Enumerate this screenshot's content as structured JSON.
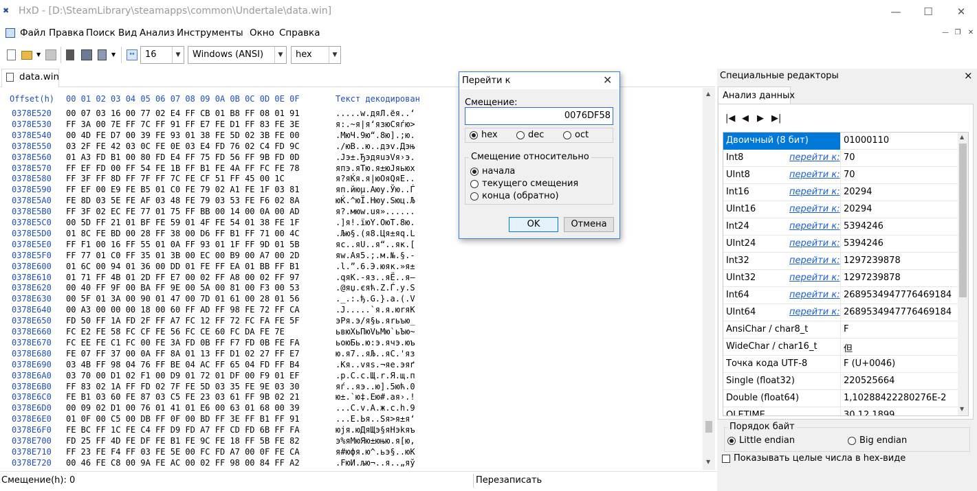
{
  "window": {
    "app_icon": "HxD-icon",
    "title": "HxD - [D:\\SteamLibrary\\steamapps\\common\\Undertale\\data.win]",
    "minimize": "—",
    "maximize": "☐",
    "close": "✕"
  },
  "menu": [
    "Файл",
    "Правка",
    "Поиск",
    "Вид",
    "Анализ",
    "Инструменты",
    "Окно",
    "Справка"
  ],
  "toolbar": {
    "bytes_per_row": "16",
    "charset": "Windows (ANSI)",
    "offset_base": "hex"
  },
  "editor_tab": "data.win",
  "hex_header": {
    "offset_label": "Offset(h)",
    "columns": "00 01 02 03 04 05 06 07 08 09 0A 0B 0C 0D 0E 0F",
    "text_label": "Текст декодирован"
  },
  "hex_rows": [
    {
      "offset": "0378E520",
      "bytes": "00 07 03 16 00 77 02 E4 FF CB 01 B8 FF 08 01 91",
      "text": ".....w.дяЛ.ёя..‘"
    },
    {
      "offset": "0378E530",
      "bytes": "FF 3A 00 7E FF 7C FF 91 FF E7 FE D1 FF 83 FE 3E",
      "text": "я:.~я|я‘язюСяѓю>"
    },
    {
      "offset": "0378E540",
      "bytes": "00 4D FE D7 00 39 FE 93 01 38 FE 5D 02 3B FE 00",
      "text": ".MюЧ.9ю“.8ю].;ю."
    },
    {
      "offset": "0378E550",
      "bytes": "03 2F FE 42 03 0C FE 0E 03 E4 FD 76 02 C4 FD 9C",
      "text": "./юB..ю..дэv.Дэњ"
    },
    {
      "offset": "0378E560",
      "bytes": "01 A3 FD B1 00 80 FD E4 FF 75 FD 56 FF 9B FD 0D",
      "text": ".Јэ±.ЂэдяuэVя›э."
    },
    {
      "offset": "0378E570",
      "bytes": "FF EF FD 00 FF 54 FE 1B FF B1 FE 4A FF FC FE 78",
      "text": "япэ.яTю.я±юJяьюx"
    },
    {
      "offset": "0378E580",
      "bytes": "FF 3F FF 8D FF 7F FF 7C FE CF 51 FF 45 00 1C",
      "text": "я?яЌя.я|юОяQяE.."
    },
    {
      "offset": "0378E590",
      "bytes": "FF EF 00 E9 FE B5 01 C0 FE 79 02 A1 FE 1F 03 81",
      "text": "яп.йюµ.Аюy.Ўю..Ѓ"
    },
    {
      "offset": "0378E5A0",
      "bytes": "FE 8D 03 5E FE AF 03 48 FE 79 03 53 FE F6 02 8A",
      "text": "юЌ.^юЇ.Hюy.Sюц.Љ"
    },
    {
      "offset": "0378E5B0",
      "bytes": "FF 3F 02 EC FE 77 01 75 FF BB 00 14 00 0A 00 AD",
      "text": "я?.мюw.uя»......"
    },
    {
      "offset": "0378E5C0",
      "bytes": "00 5D FF 21 01 BF FE 59 01 4F FE 54 01 38 FE 1F",
      "text": ".]я!.їюY.OюT.8ю."
    },
    {
      "offset": "0378E5D0",
      "bytes": "01 8C FE BD 00 28 FF 38 00 D6 FF B1 FF 71 00 4C",
      "text": ".Љю§.(я8.Ця±яq.L"
    },
    {
      "offset": "0378E5E0",
      "bytes": "FF F1 00 16 FF 55 01 0A FF 93 01 1F FF 9D 01 5B",
      "text": "яс..яU..я“..як.["
    },
    {
      "offset": "0378E5F0",
      "bytes": "FF 77 01 C0 FF 35 01 3B 00 EC 00 B9 00 A7 00 2D",
      "text": "яw.Ая5.;.м.№.§.-"
    },
    {
      "offset": "0378E600",
      "bytes": "01 6C 00 94 01 36 00 DD 01 FE FF EA 01 BB FF B1",
      "text": ".l.”.6.Э.юяк.»я±"
    },
    {
      "offset": "0378E610",
      "bytes": "01 71 FF 4B 01 2D FF E7 00 02 FF A8 00 02 FF 97",
      "text": ".qяK.-яз..яЁ..я—"
    },
    {
      "offset": "0378E620",
      "bytes": "00 40 FF 9F 00 BA FF 9E 00 5A 00 81 00 F3 00 53",
      "text": ".@яџ.єяћ.Z.Ѓ.у.S"
    },
    {
      "offset": "0378E630",
      "bytes": "00 5F 01 3A 00 90 01 47 00 7D 01 61 00 28 01 56",
      "text": "._.:.ђ.G.}.a.(.V"
    },
    {
      "offset": "0378E640",
      "bytes": "00 A3 00 00 00 18 00 60 FF AD FF 98 FE 72 FF CA",
      "text": ".Ј.....`я.я.юrяК"
    },
    {
      "offset": "0378E650",
      "bytes": "FD 50 FF 1A FD 2F FF A7 FC 12 FF 72 FC FA FE 5F",
      "text": "эPя.э/я§ь.яrьъю_"
    },
    {
      "offset": "0378E660",
      "bytes": "FC E2 FE 58 FC CF FE 56 FC CE 60 FC DA FE 7E",
      "text": "ьвюXьПюVьМю`ьЪю~"
    },
    {
      "offset": "0378E670",
      "bytes": "FC EE FE C1 FC 00 FE 3A FD 0B FF F7 FD 0B FE FA",
      "text": "ьоюБь.ю:э.ячэ.юъ"
    },
    {
      "offset": "0378E680",
      "bytes": "FE 07 FF 37 00 0A FF 8A 01 13 FF D1 02 27 FF E7",
      "text": "ю.я7..яЉ..яС.'яз"
    },
    {
      "offset": "0378E690",
      "bytes": "03 4B FF 98 04 76 FF BE 04 AC FF 65 04 FD FF B4",
      "text": ".Kя..vяѕ.¬яe.эяґ"
    },
    {
      "offset": "0378E6A0",
      "bytes": "03 70 00 D1 02 F1 00 D9 01 72 01 DF 00 F9 01 EF",
      "text": ".p.С.с.Щ.r.Я.щ.п"
    },
    {
      "offset": "0378E6B0",
      "bytes": "FF 83 02 1A FF FD 02 7F FE 5D 03 35 FE 9E 03 30",
      "text": "яѓ..яэ..ю].5юћ.0"
    },
    {
      "offset": "0378E6C0",
      "bytes": "FE B1 03 60 FE 87 03 C5 FE 23 03 61 FF 9B 02 21",
      "text": "ю±.`ю‡.Ею#.aя›.!"
    },
    {
      "offset": "0378E6D0",
      "bytes": "00 09 02 D1 00 76 01 41 01 E6 00 63 01 68 00 39",
      "text": "...С.v.A.ж.c.h.9"
    },
    {
      "offset": "0378E6E0",
      "bytes": "01 0F 00 C5 00 DB FF 0F 00 BD FF 3E FF B1 FF 91",
      "text": "...Е.Ья..Ѕя>я±я‘"
    },
    {
      "offset": "0378E6F0",
      "bytes": "FE BC FF 1C FE C4 FF D9 FD A7 FF CD FD 6B FF FA",
      "text": "юјя.юДяЩэ§яНэkяъ"
    },
    {
      "offset": "0378E700",
      "bytes": "FD 25 FF 4D FE DF FE B1 FE 9C FE 18 FF 5B FE 82",
      "text": "э%яMюЯю±юњю.я[ю‚"
    },
    {
      "offset": "0378E710",
      "bytes": "FF 23 FE F4 FF 03 FE 5E 00 FC FD A7 00 0F FE CA",
      "text": "я#юфя.ю^.ьэ§..юК"
    },
    {
      "offset": "0378E720",
      "bytes": "00 46 FE C8 00 9A FE AC 00 02 FF 98 00 84 FF A2",
      "text": ".FюИ.љю¬..я..„яў"
    }
  ],
  "status": {
    "offset": "Смещение(h): 0",
    "mode": "Перезаписать"
  },
  "right_panel": {
    "title": "Специальные редакторы",
    "close": "×",
    "tab": "Анализ данных",
    "nav": [
      "first-icon",
      "prev-icon",
      "next-icon",
      "last-icon"
    ],
    "nav_glyphs": [
      "|◀",
      "◀",
      "▶",
      "▶|"
    ],
    "rows": [
      {
        "name": "Двоичный (8 бит)",
        "link": "",
        "value": "01000110",
        "selected": true
      },
      {
        "name": "Int8",
        "link": "перейти к:",
        "value": "70"
      },
      {
        "name": "UInt8",
        "link": "перейти к:",
        "value": "70"
      },
      {
        "name": "Int16",
        "link": "перейти к:",
        "value": "20294"
      },
      {
        "name": "UInt16",
        "link": "перейти к:",
        "value": "20294"
      },
      {
        "name": "Int24",
        "link": "перейти к:",
        "value": "5394246"
      },
      {
        "name": "UInt24",
        "link": "перейти к:",
        "value": "5394246"
      },
      {
        "name": "Int32",
        "link": "перейти к:",
        "value": "1297239878"
      },
      {
        "name": "UInt32",
        "link": "перейти к:",
        "value": "1297239878"
      },
      {
        "name": "Int64",
        "link": "перейти к:",
        "value": "2689534947776469184"
      },
      {
        "name": "UInt64",
        "link": "перейти к:",
        "value": "2689534947776469184"
      },
      {
        "name": "AnsiChar / char8_t",
        "link": "",
        "value": "F"
      },
      {
        "name": "WideChar / char16_t",
        "link": "",
        "value": "但"
      },
      {
        "name": "Точка кода UTF-8",
        "link": "",
        "value": "F (U+0046)"
      },
      {
        "name": "Single (float32)",
        "link": "",
        "value": "220525664"
      },
      {
        "name": "Double (float64)",
        "link": "",
        "value": "1,10288422280276E-2"
      },
      {
        "name": "OLETIME",
        "link": "",
        "value": "30.12.1899"
      }
    ],
    "byte_order": {
      "title": "Порядок байт",
      "little": "Little endian",
      "big": "Big endian"
    },
    "hex_ints_label": "Показывать целые числа в hex-виде"
  },
  "dialog": {
    "title": "Перейти к",
    "close": "✕",
    "offset_label": "Смещение:",
    "offset_value": "0076DF58",
    "radix": {
      "hex": "hex",
      "dec": "dec",
      "oct": "oct"
    },
    "relative_title": "Смещение относительно",
    "relative": {
      "start": "начала",
      "current": "текущего смещения",
      "end": "конца (обратно)"
    },
    "ok": "OK",
    "cancel": "Отмена"
  },
  "colors": {
    "selection": "#0078d7",
    "accent": "#1f4fb5",
    "link": "#1a5fd0"
  }
}
